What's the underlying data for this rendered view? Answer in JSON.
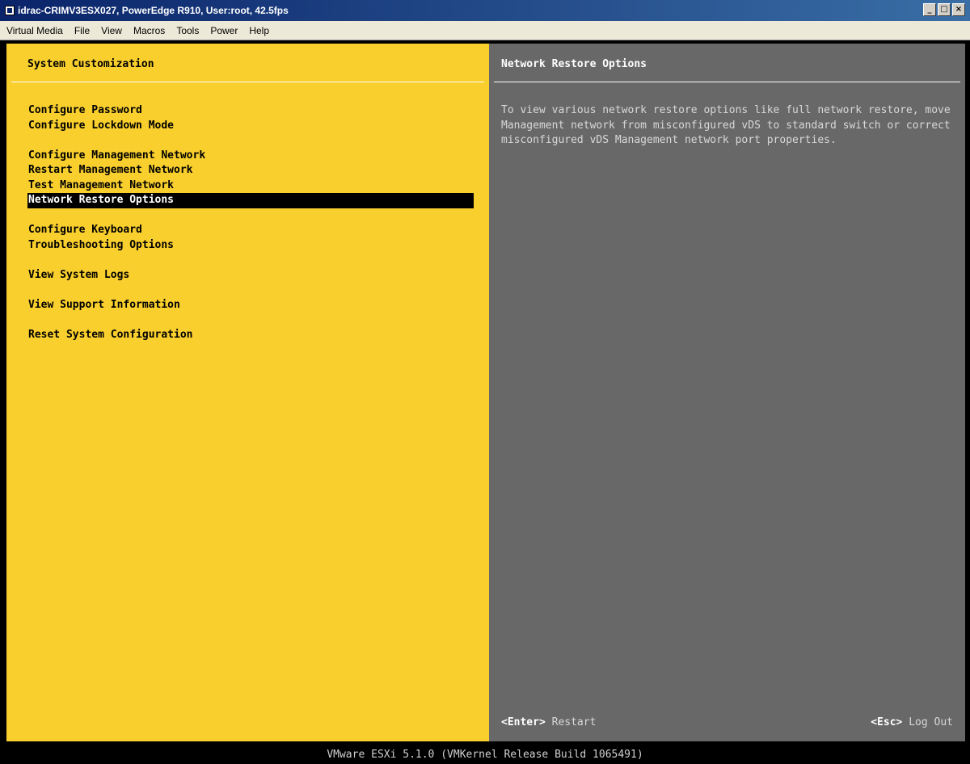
{
  "window": {
    "title": "idrac-CRIMV3ESX027, PowerEdge R910, User:root, 42.5fps",
    "controls": [
      "_",
      "□",
      "×"
    ]
  },
  "menubar": [
    "Virtual Media",
    "File",
    "View",
    "Macros",
    "Tools",
    "Power",
    "Help"
  ],
  "left_pane": {
    "title": "System Customization",
    "groups": [
      [
        "Configure Password",
        "Configure Lockdown Mode"
      ],
      [
        "Configure Management Network",
        "Restart Management Network",
        "Test Management Network",
        "Network Restore Options"
      ],
      [
        "Configure Keyboard",
        "Troubleshooting Options"
      ],
      [
        "View System Logs"
      ],
      [
        "View Support Information"
      ],
      [
        "Reset System Configuration"
      ]
    ],
    "selected": "Network Restore Options"
  },
  "right_pane": {
    "title": "Network Restore Options",
    "description": "To view various network restore options like full network restore, move Management network from misconfigured vDS to standard switch  or correct misconfigured vDS Management network port properties.",
    "footer_left_key": "<Enter>",
    "footer_left_action": "Restart",
    "footer_right_key": "<Esc>",
    "footer_right_action": "Log Out"
  },
  "status_bar": "VMware ESXi 5.1.0 (VMKernel Release Build 1065491)",
  "colors": {
    "left_bg": "#f9cf2e",
    "right_bg": "#686868",
    "selected_bg": "#000000"
  }
}
